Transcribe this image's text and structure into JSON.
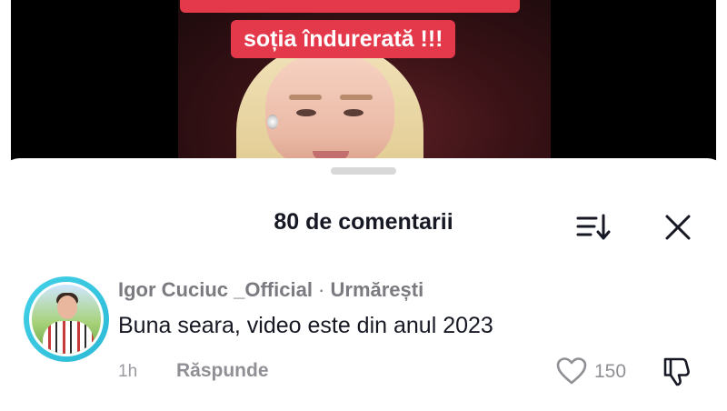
{
  "video": {
    "caption": "soția îndurerată !!!"
  },
  "comments_header": {
    "count_label": "80 de comentarii"
  },
  "comment": {
    "username": "Igor Cuciuc _Official",
    "separator": " · ",
    "follow_status": "Urmărești",
    "text": "Buna seara, video este din anul 2023",
    "time": "1h",
    "reply_label": "Răspunde",
    "like_count": "150"
  },
  "icons": {
    "sort": "sort-icon",
    "close": "close-icon",
    "like": "heart-icon",
    "dislike": "thumbs-down-icon"
  },
  "colors": {
    "caption_background": "#e4394a",
    "avatar_ring": "#2bb9d6",
    "primary_text": "#161823",
    "secondary_text": "#8f8f95"
  }
}
